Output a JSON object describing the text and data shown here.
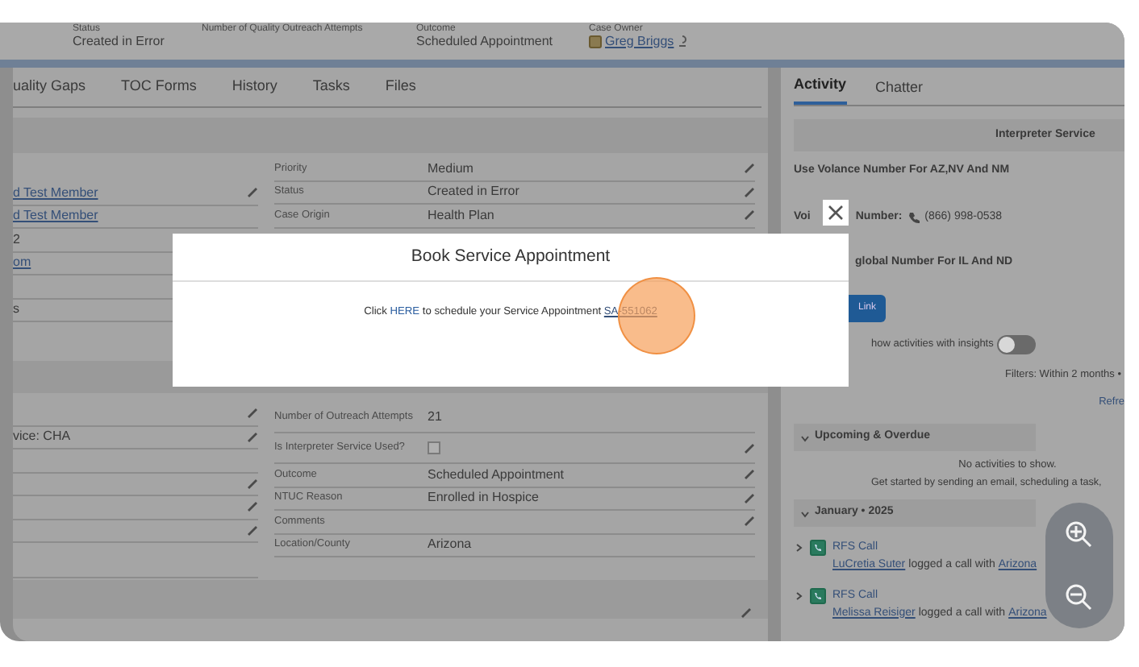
{
  "header_fields": [
    {
      "label": "Status",
      "value": "Created in Error",
      "kind": "text"
    },
    {
      "label": "Number of Quality Outreach Attempts",
      "kind": "none"
    },
    {
      "label": "Outcome",
      "value": "Scheduled Appointment",
      "kind": "text"
    },
    {
      "label": "Case Owner",
      "value": "Greg Briggs",
      "kind": "owner"
    }
  ],
  "tabs": [
    {
      "label": "uality Gaps",
      "selected": false
    },
    {
      "label": "TOC Forms",
      "selected": false
    },
    {
      "label": "History",
      "selected": false
    },
    {
      "label": "Tasks",
      "selected": false
    },
    {
      "label": "Files",
      "selected": false
    }
  ],
  "section_1": {
    "left_rows": [
      {
        "value": "d Test Member",
        "kind": "link",
        "editable": true
      },
      {
        "value": "d Test Member",
        "kind": "link",
        "editable": false
      },
      {
        "value": "2",
        "kind": "text",
        "editable": false
      },
      {
        "value": "om",
        "kind": "link",
        "editable": false
      },
      {
        "kind": "blank",
        "editable": false
      },
      {
        "value": "s",
        "kind": "text",
        "editable": false
      }
    ],
    "right_rows": [
      {
        "label": "Priority",
        "value": "Medium",
        "kind": "text",
        "editable": true
      },
      {
        "label": "Status",
        "value": "Created in Error",
        "kind": "text",
        "editable": true
      },
      {
        "label": "Case Origin",
        "value": "Health Plan",
        "kind": "text",
        "editable": true
      }
    ]
  },
  "section_2": {
    "left_rows": [
      {
        "kind": "blank",
        "editable": true
      },
      {
        "value": "vice: CHA",
        "kind": "text",
        "editable": true
      },
      {
        "kind": "blank",
        "editable": false
      },
      {
        "kind": "blank",
        "editable": true
      },
      {
        "kind": "blank",
        "editable": true
      },
      {
        "kind": "blank",
        "editable": true
      },
      {
        "kind": "blank",
        "editable": false
      }
    ],
    "right_rows": [
      {
        "label": "Number of Outreach Attempts",
        "value": "21",
        "kind": "text",
        "editable": false
      },
      {
        "label": "Is Interpreter Service Used?",
        "kind": "checkbox",
        "checked": false,
        "editable": true
      },
      {
        "label": "Outcome",
        "value": "Scheduled Appointment",
        "kind": "text",
        "editable": true
      },
      {
        "label": "NTUC Reason",
        "value": "Enrolled in Hospice",
        "kind": "text",
        "editable": true
      },
      {
        "label": "Comments",
        "kind": "text",
        "editable": true
      },
      {
        "label": "Location/County",
        "value": "Arizona",
        "kind": "text",
        "editable": false
      }
    ]
  },
  "activity_panel": {
    "tabs": [
      {
        "label": "Activity",
        "selected": true
      },
      {
        "label": "Chatter",
        "selected": false
      }
    ],
    "interpreter_card": {
      "title": "Interpreter Service",
      "line_1": "Use Volance Number For AZ,NV And NM",
      "voice_label_start": "Voi",
      "voice_label_end": "Number:",
      "phone": "(866) 998-0538",
      "line_3": "global Number For IL And ND",
      "button": "Link"
    },
    "insights_toggle": {
      "label": "how activities with insights",
      "on": false
    },
    "filters": "Filters: Within 2 months •",
    "refresh": "Refre",
    "sections": [
      {
        "title": "Upcoming & Overdue",
        "expanded": true,
        "empty_title": "No activities to show.",
        "empty_text": "Get started by sending an email, scheduling a task,"
      },
      {
        "title": "January • 2025",
        "expanded": true,
        "items": [
          {
            "title": "RFS Call",
            "expanded": false,
            "person": "LuCretia Suter",
            "action": "logged a call with",
            "target": "Arizona"
          },
          {
            "title": "RFS Call",
            "expanded": false,
            "person": "Melissa Reisiger",
            "action": "logged a call with",
            "target": "Arizona"
          }
        ]
      }
    ]
  },
  "modal": {
    "title": "Book Service Appointment",
    "text_before": "Click",
    "link_here": "HERE",
    "text_middle": "to schedule your Service Appointment",
    "appointment_link": "SA-551062"
  }
}
